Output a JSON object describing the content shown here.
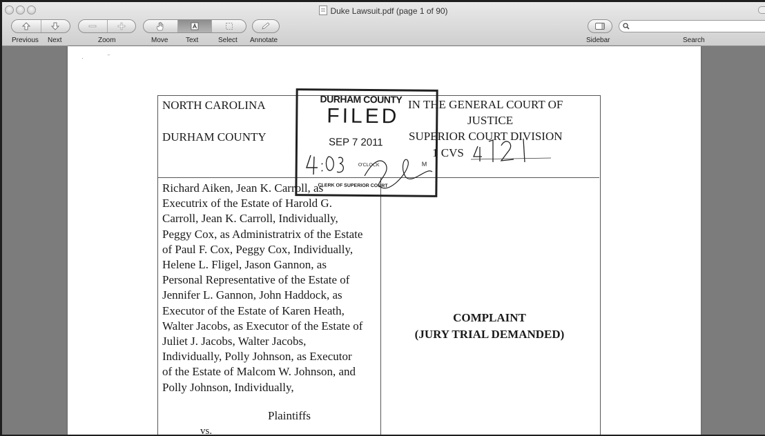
{
  "window": {
    "title": "Duke Lawsuit.pdf (page 1 of 90)"
  },
  "toolbar": {
    "previous_label": "Previous",
    "next_label": "Next",
    "zoom_label": "Zoom",
    "move_label": "Move",
    "text_label": "Text",
    "select_label": "Select",
    "annotate_label": "Annotate",
    "sidebar_label": "Sidebar",
    "search_label": "Search",
    "active_tool": "Text"
  },
  "search": {
    "value": "",
    "placeholder": ""
  },
  "icons": {
    "previous": "arrow-up-icon",
    "next": "arrow-down-icon",
    "zoom_out": "minus-icon",
    "zoom_in": "plus-icon",
    "move": "hand-icon",
    "text": "text-cursor-icon",
    "select": "marquee-icon",
    "annotate": "pencil-icon",
    "sidebar": "sidebar-icon",
    "search": "magnifier-icon"
  },
  "document": {
    "state": "NORTH CAROLINA",
    "county": "DURHAM COUNTY",
    "court_line1": "IN THE GENERAL COURT OF",
    "court_line2": "JUSTICE",
    "court_line3": "SUPERIOR COURT DIVISION",
    "case_prefix": "1 CVS",
    "case_number_handwritten": "4121",
    "party_lines": [
      "Richard Aiken, Jean K. Carroll, as",
      "Executrix of the Estate of Harold G.",
      "Carroll, Jean K. Carroll, Individually,",
      "Peggy Cox, as Administratrix of the Estate",
      "of Paul F. Cox, Peggy Cox, Individually,",
      "Helene L. Fligel, Jason Gannon, as",
      "Personal Representative of the Estate of",
      "Jennifer L. Gannon, John Haddock, as",
      "Executor of the Estate of Karen Heath,",
      "Walter Jacobs, as Executor of the Estate of",
      "Juliet J. Jacobs, Walter Jacobs,",
      "Individually, Polly Johnson, as Executor",
      "of the Estate of Malcom W. Johnson, and",
      "Polly Johnson, Individually,"
    ],
    "plaintiffs": "Plaintiffs",
    "vs": "vs.",
    "complaint_title": "COMPLAINT",
    "complaint_subtitle": "(JURY TRIAL DEMANDED)"
  },
  "stamp": {
    "county": "DURHAM COUNTY",
    "filed": "FILED",
    "date": "SEP  7  2011",
    "oclock": "O'CLOCK",
    "m": "M",
    "clerk": "CLERK OF SUPERIOR COURT",
    "handwritten_time": "4:03"
  }
}
